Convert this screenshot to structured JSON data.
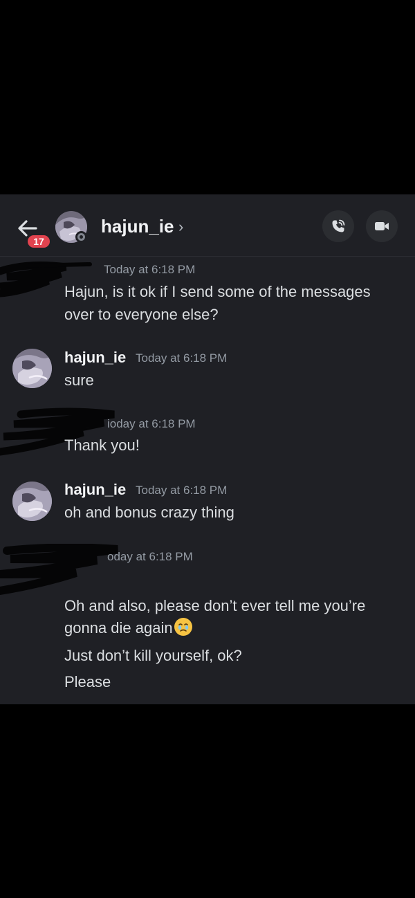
{
  "header": {
    "back_icon": "arrow-left-icon",
    "unread_count": "17",
    "username": "hajun_ie",
    "chevron": "›",
    "call_icon": "phone-call-icon",
    "video_icon": "video-camera-icon"
  },
  "messages": [
    {
      "author": "",
      "timestamp": "Today at 6:18 PM",
      "lines": [
        "Hajun, is it ok if I send some of the messages",
        "over to everyone else?"
      ]
    },
    {
      "author": "hajun_ie",
      "timestamp": "Today at 6:18 PM",
      "lines": [
        "sure"
      ]
    },
    {
      "author": "",
      "timestamp": "ioday at 6:18 PM",
      "lines": [
        "Thank you!"
      ]
    },
    {
      "author": "hajun_ie",
      "timestamp": "Today at 6:18 PM",
      "lines": [
        "oh and bonus crazy thing"
      ]
    },
    {
      "author": "",
      "timestamp": "oday at 6:18 PM",
      "lines": [
        "Oh and also, please don’t ever tell me you’re",
        "gonna die again",
        "Just don’t kill yourself, ok?",
        "Please"
      ],
      "emoji": "face-holding-back-tears"
    }
  ],
  "colors": {
    "background": "#1f2025",
    "badge": "#e2434f",
    "outer": "#000000"
  }
}
